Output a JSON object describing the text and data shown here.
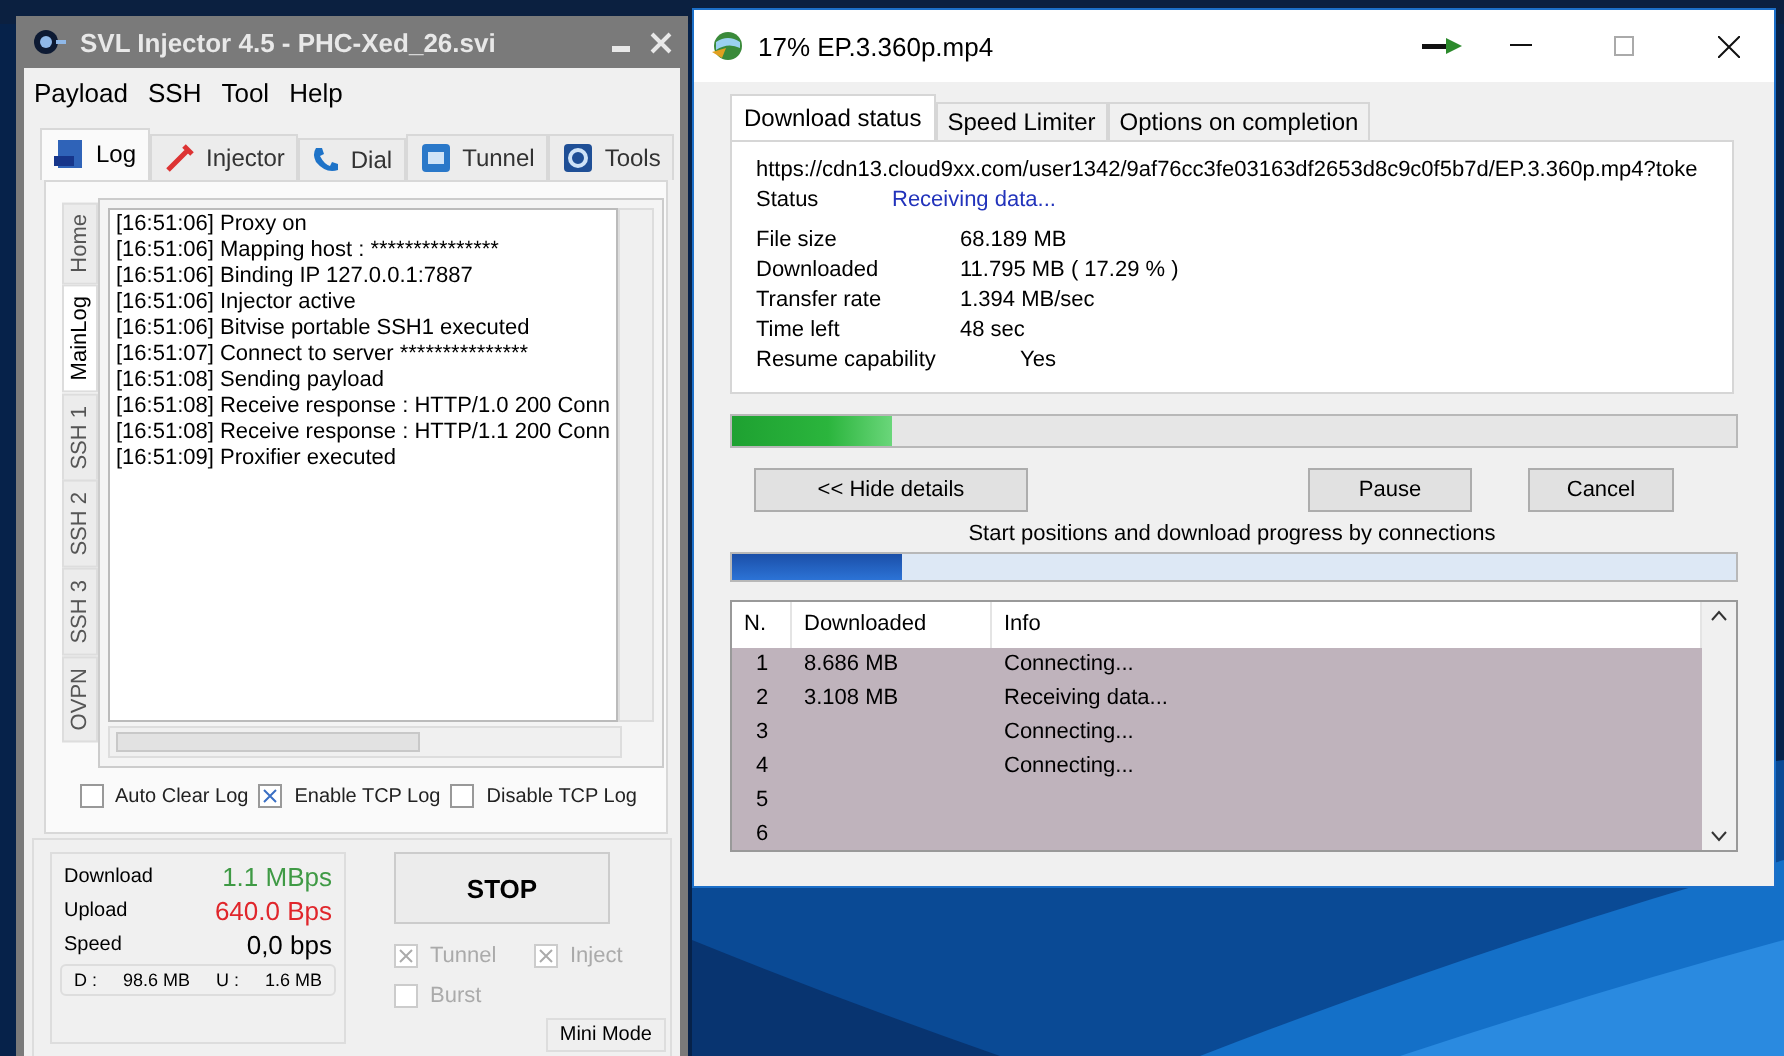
{
  "injector": {
    "title": "SVL Injector 4.5 - PHC-Xed_26.svi",
    "menu": [
      "Payload",
      "SSH",
      "Tool",
      "Help"
    ],
    "tabs": [
      {
        "label": "Log",
        "kind": "log",
        "selected": true
      },
      {
        "label": "Injector",
        "kind": "injector",
        "selected": false
      },
      {
        "label": "Dial",
        "kind": "dial",
        "selected": false
      },
      {
        "label": "Tunnel",
        "kind": "tunnel",
        "selected": false
      },
      {
        "label": "Tools",
        "kind": "tools",
        "selected": false
      }
    ],
    "side_tabs": [
      {
        "label": "Home",
        "selected": false
      },
      {
        "label": "MainLog",
        "selected": true
      },
      {
        "label": "SSH 1",
        "selected": false
      },
      {
        "label": "SSH 2",
        "selected": false
      },
      {
        "label": "SSH 3",
        "selected": false
      },
      {
        "label": "OVPN",
        "selected": false
      }
    ],
    "log_lines": [
      "[16:51:06] Proxy on",
      "[16:51:06] Mapping host : ***************",
      "[16:51:06] Binding IP 127.0.0.1:7887",
      "[16:51:06] Injector active",
      "[16:51:06] Bitvise portable SSH1 executed",
      "[16:51:07] Connect to server ***************",
      "[16:51:08] Sending payload",
      "[16:51:08] Receive response : HTTP/1.0 200 Conn",
      "[16:51:08] Receive response : HTTP/1.1 200 Conn",
      "[16:51:09] Proxifier executed"
    ],
    "options": [
      {
        "label": "Auto Clear Log",
        "checked": false
      },
      {
        "label": "Enable TCP Log",
        "checked": true
      },
      {
        "label": "Disable TCP Log",
        "checked": false
      }
    ],
    "stats": [
      {
        "label": "Download",
        "value": "1.1 MBps",
        "color": "#3f9a45"
      },
      {
        "label": "Upload",
        "value": "640.0 Bps",
        "color": "#e0262b"
      },
      {
        "label": "Speed",
        "value": "0,0 bps",
        "color": "#000000"
      }
    ],
    "totals": {
      "d_label": "D :",
      "d_value": "98.6 MB",
      "u_label": "U :",
      "u_value": "1.6 MB"
    },
    "stop_button": "STOP",
    "modes": [
      {
        "label": "Tunnel",
        "checked": true
      },
      {
        "label": "Inject",
        "checked": true
      },
      {
        "label": "Burst",
        "checked": false
      }
    ],
    "mini_mode": "Mini Mode"
  },
  "download": {
    "title": "17% EP.3.360p.mp4",
    "tabs": [
      {
        "label": "Download status",
        "selected": true
      },
      {
        "label": "Speed Limiter",
        "selected": false
      },
      {
        "label": "Options on completion",
        "selected": false
      }
    ],
    "url": "https://cdn13.cloud9xx.com/user1342/9af76cc3fe03163df2653d8c9c0f5b7d/EP.3.360p.mp4?toke",
    "status_label": "Status",
    "status": "Receiving data...",
    "details": [
      {
        "label": "File size",
        "value": "68.189  MB"
      },
      {
        "label": "Downloaded",
        "value": "11.795  MB  ( 17.29 % )"
      },
      {
        "label": "Transfer rate",
        "value": "1.394  MB/sec"
      },
      {
        "label": "Time left",
        "value": "48 sec"
      },
      {
        "label": "Resume capability",
        "value": "Yes"
      }
    ],
    "progress": {
      "level": 0.16
    },
    "buttons": {
      "hide": "<< Hide details",
      "pause": "Pause",
      "cancel": "Cancel"
    },
    "connections_caption": "Start positions and download progress by connections",
    "connections_progress": {
      "level": 0.17
    },
    "columns": [
      "N.",
      "Downloaded",
      "Info"
    ],
    "rows": [
      {
        "n": "1",
        "downloaded": "8.686  MB",
        "info": "Connecting..."
      },
      {
        "n": "2",
        "downloaded": "3.108  MB",
        "info": "Receiving data..."
      },
      {
        "n": "3",
        "info": "Connecting..."
      },
      {
        "n": "4",
        "info": "Connecting..."
      },
      {
        "n": "5"
      },
      {
        "n": "6"
      }
    ]
  }
}
